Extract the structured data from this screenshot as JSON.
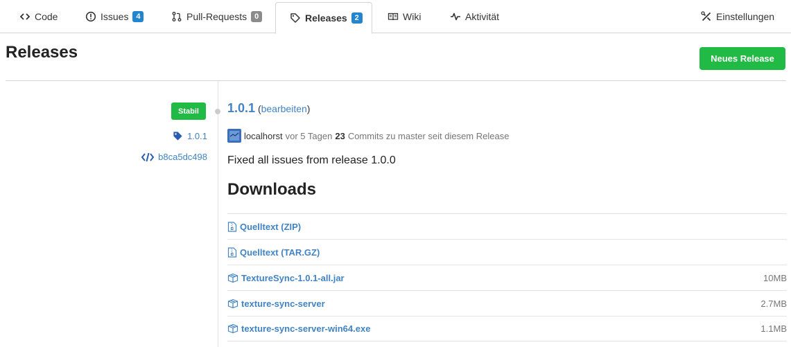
{
  "tabs": [
    {
      "label": "Code",
      "icon": "code-icon"
    },
    {
      "label": "Issues",
      "icon": "issue-icon",
      "badge": "4"
    },
    {
      "label": "Pull-Requests",
      "icon": "pull-request-icon",
      "badge": "0"
    },
    {
      "label": "Releases",
      "icon": "tag-icon",
      "badge": "2"
    },
    {
      "label": "Wiki",
      "icon": "book-icon"
    },
    {
      "label": "Aktivität",
      "icon": "pulse-icon"
    },
    {
      "label": "Einstellungen",
      "icon": "tools-icon"
    }
  ],
  "header": {
    "title": "Releases",
    "new_release_label": "Neues Release"
  },
  "release": {
    "badge": "Stabil",
    "tag": "1.0.1",
    "commit": "b8ca5dc498",
    "version": "1.0.1",
    "edit_label": "bearbeiten",
    "author": "localhorst",
    "ago": "vor 5 Tagen",
    "commit_count": "23",
    "commits_text": "Commits zu master seit diesem Release",
    "note": "Fixed all issues from release 1.0.0"
  },
  "downloads": {
    "title": "Downloads",
    "items": [
      {
        "name": "Quelltext (ZIP)",
        "size": "",
        "icon": "file-zip-icon"
      },
      {
        "name": "Quelltext (TAR.GZ)",
        "size": "",
        "icon": "file-zip-icon"
      },
      {
        "name": "TextureSync-1.0.1-all.jar",
        "size": "10MB",
        "icon": "package-icon"
      },
      {
        "name": "texture-sync-server",
        "size": "2.7MB",
        "icon": "package-icon"
      },
      {
        "name": "texture-sync-server-win64.exe",
        "size": "1.1MB",
        "icon": "package-icon"
      }
    ]
  },
  "colors": {
    "primary": "#4183c4",
    "green": "#21ba45",
    "badge_blue": "#2185d0",
    "badge_grey": "#8c8c8c"
  }
}
